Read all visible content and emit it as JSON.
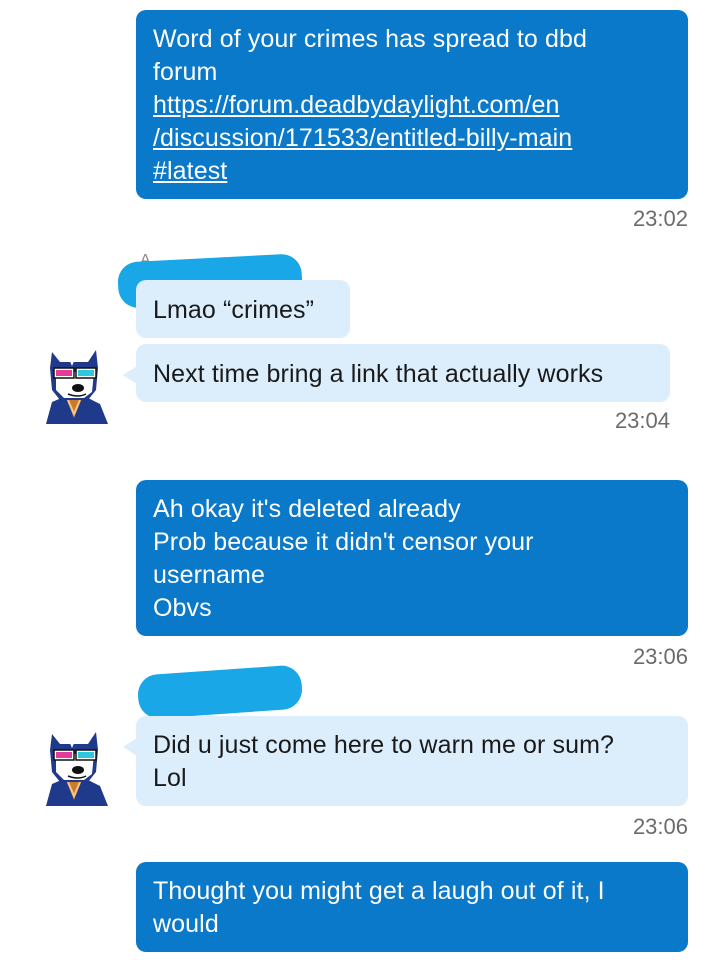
{
  "messages": [
    {
      "lines": [
        "Word of your crimes has spread to dbd",
        "forum"
      ],
      "link": [
        "https://forum.deadbydaylight.com/en",
        "/discussion/171533/entitled-billy-main",
        "#latest"
      ],
      "time": "23:02"
    },
    {
      "text": "Lmao “crimes”"
    },
    {
      "text": "Next time bring a link that actually works",
      "time": "23:04"
    },
    {
      "lines": [
        "Ah okay it's deleted already",
        "Prob because it didn't censor your",
        "username",
        "Obvs"
      ],
      "time": "23:06"
    },
    {
      "lines": [
        "Did u just come here to warn me or sum?",
        "Lol"
      ],
      "time": "23:06"
    },
    {
      "lines": [
        "Thought you might get a laugh out of it, I",
        "would"
      ]
    }
  ],
  "colors": {
    "outgoing_bubble": "#0a79c9",
    "incoming_bubble": "#dcedfc",
    "redaction": "#1aa7e8"
  },
  "icons": {
    "avatar": "cartoon-dog-with-3d-glasses-avatar"
  }
}
